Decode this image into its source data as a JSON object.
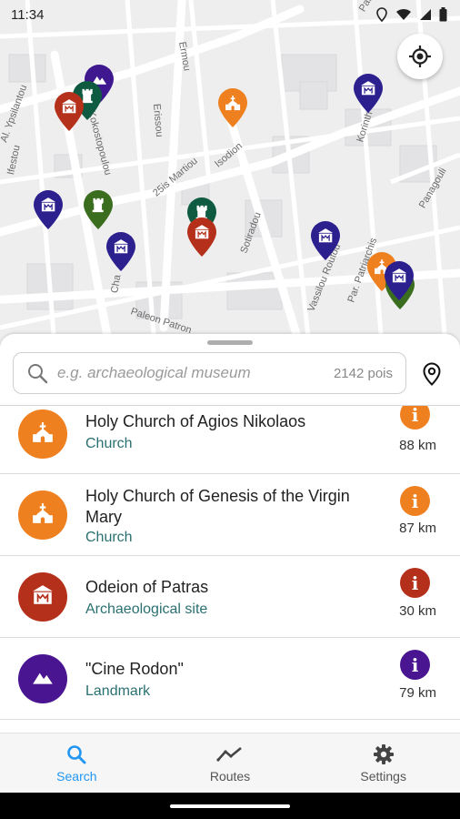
{
  "status": {
    "time": "11:34"
  },
  "map": {
    "streets": [
      "Ermou",
      "Al. Ypsilantou",
      "Ifestou",
      "Kokostopoulou",
      "Erissou",
      "25is Martiou",
      "Isodion",
      "Sotiradou",
      "Vassilou Routou",
      "Korinth",
      "Panagouli",
      "Par. Patriarchis",
      "Paleon Patron",
      "Cha",
      "Patriarchi"
    ],
    "pins": [
      {
        "color": "#3f178f",
        "icon": "landmark-icon"
      },
      {
        "color": "#0e5b42",
        "icon": "castle-icon"
      },
      {
        "color": "#b5301a",
        "icon": "museum-icon"
      },
      {
        "color": "#ef8020",
        "icon": "church-icon"
      },
      {
        "color": "#2c1f8e",
        "icon": "museum-icon"
      },
      {
        "color": "#2c1f8e",
        "icon": "museum-icon"
      },
      {
        "color": "#3a6e1e",
        "icon": "castle-icon"
      },
      {
        "color": "#0e5b42",
        "icon": "castle-icon"
      },
      {
        "color": "#b5301a",
        "icon": "museum-icon"
      },
      {
        "color": "#2c1f8e",
        "icon": "museum-icon"
      },
      {
        "color": "#2c1f8e",
        "icon": "museum-icon"
      },
      {
        "color": "#ef8020",
        "icon": "church-icon"
      },
      {
        "color": "#3a6e1e",
        "icon": "castle-icon"
      },
      {
        "color": "#2c1f8e",
        "icon": "museum-icon"
      }
    ]
  },
  "search": {
    "placeholder": "e.g. archaeological museum",
    "count": "2142 pois"
  },
  "results": [
    {
      "name": " Holy Church of Agios Nikolaos",
      "category": "Church",
      "distance": "88 km",
      "color": "#ef8020",
      "icon": "church-icon",
      "info": "i"
    },
    {
      "name": " Holy Church of Genesis of the Virgin Mary",
      "category": "Church",
      "distance": "87 km",
      "color": "#ef8020",
      "icon": "church-icon",
      "info": "i"
    },
    {
      "name": " Odeion of Patras",
      "category": "Archaeological site",
      "distance": "30 km",
      "color": "#b5301a",
      "icon": "museum-icon",
      "info": "i"
    },
    {
      "name": "\"Cine Rodon\"",
      "category": "Landmark",
      "distance": "79 km",
      "color": "#4a1590",
      "icon": "landmark-icon",
      "info": "i"
    }
  ],
  "nav": [
    {
      "label": "Search",
      "icon": "search-icon",
      "active": true
    },
    {
      "label": "Routes",
      "icon": "routes-icon",
      "active": false
    },
    {
      "label": "Settings",
      "icon": "gear-icon",
      "active": false
    }
  ],
  "colors": {
    "accent": "#2196f3",
    "category_text": "#2a7071"
  }
}
